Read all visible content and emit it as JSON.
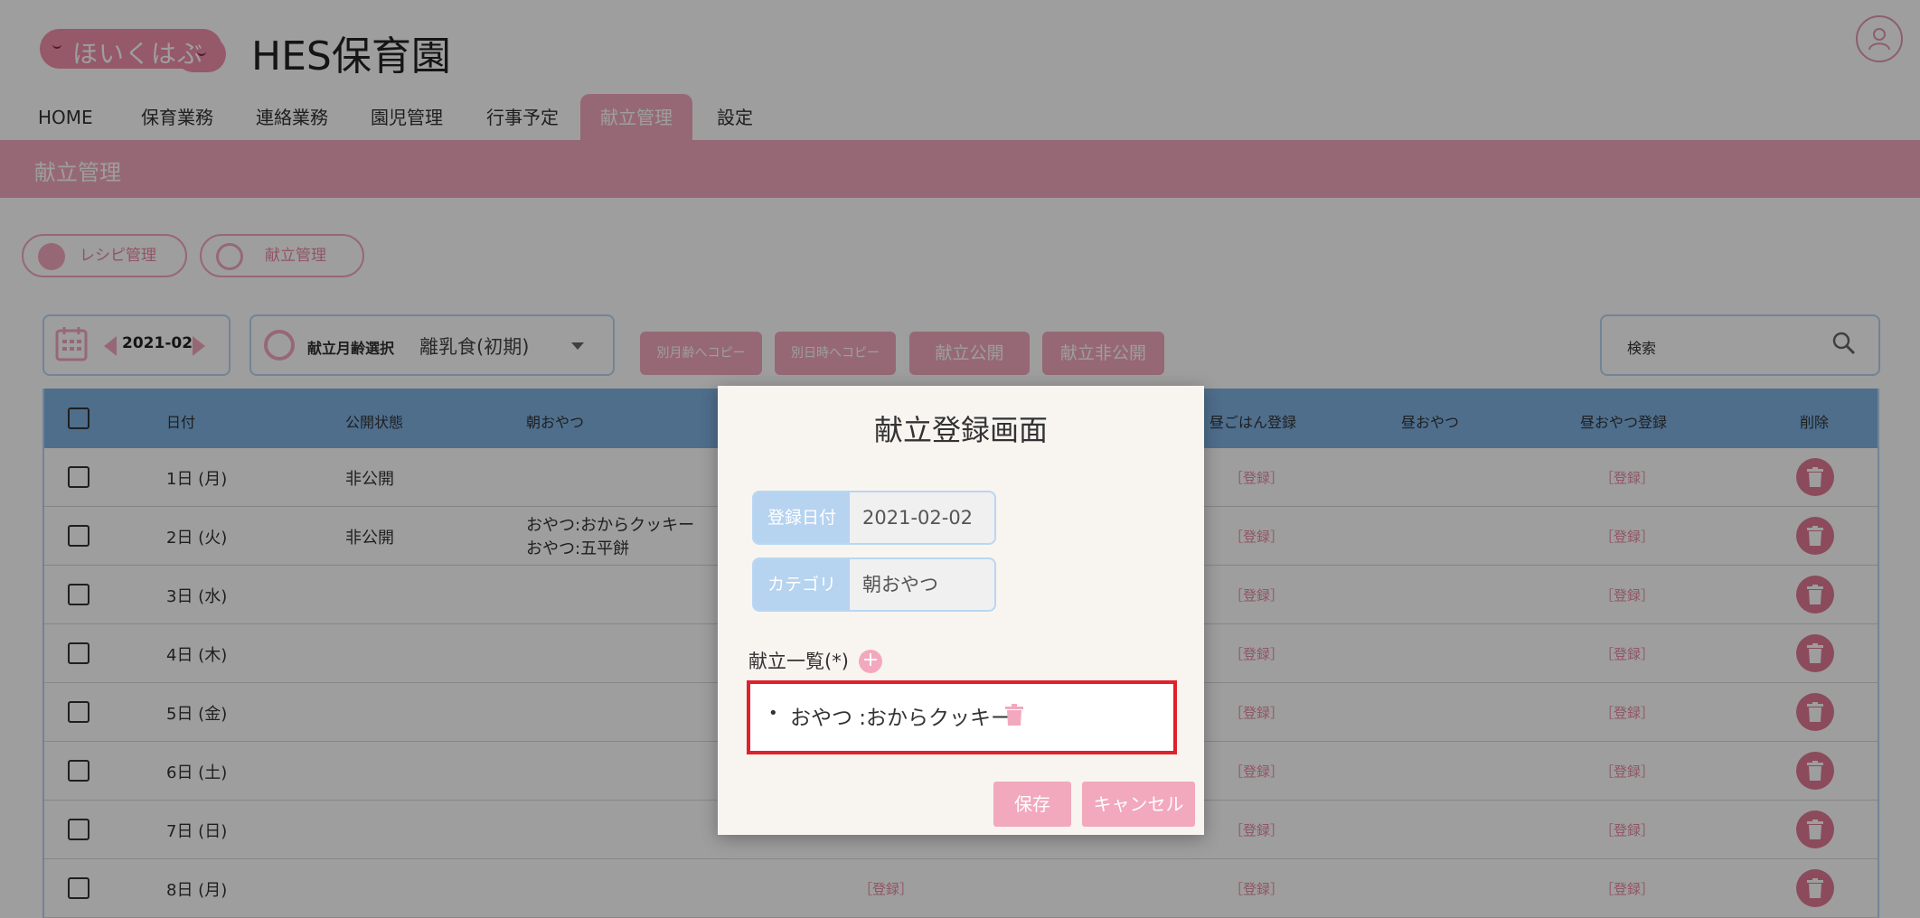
{
  "header": {
    "logo_text": "ほいくはぶ",
    "nursery_name": "HES保育園"
  },
  "nav": {
    "items": [
      "HOME",
      "保育業務",
      "連絡業務",
      "園児管理",
      "行事予定",
      "献立管理",
      "設定"
    ],
    "active": "献立管理"
  },
  "page": {
    "title": "献立管理"
  },
  "tabs": {
    "recipe": "レシピ管理",
    "menu": "献立管理"
  },
  "toolbar": {
    "month": "2021-02",
    "age_label": "献立月齢選択",
    "age_value": "離乳食(初期)",
    "copy_other_age": "別月齢へコピー",
    "copy_other_date": "別日時へコピー",
    "publish": "献立公開",
    "unpublish": "献立非公開",
    "search_placeholder": "検索"
  },
  "table": {
    "headers": {
      "date": "日付",
      "status": "公開状態",
      "morning_snack": "朝おやつ",
      "lunch_register": "昼ごはん登録",
      "afternoon_snack": "昼おやつ",
      "afternoon_snack_register": "昼おやつ登録",
      "delete": "削除"
    },
    "register_label": "［登録］",
    "rows": [
      {
        "date": "1日 (月)",
        "status": "非公開",
        "snack_line1": "",
        "snack_line2": ""
      },
      {
        "date": "2日 (火)",
        "status": "非公開",
        "snack_line1": "おやつ:おからクッキー",
        "snack_line2": "おやつ:五平餅"
      },
      {
        "date": "3日 (水)",
        "status": "",
        "snack_line1": "",
        "snack_line2": ""
      },
      {
        "date": "4日 (木)",
        "status": "",
        "snack_line1": "",
        "snack_line2": ""
      },
      {
        "date": "5日 (金)",
        "status": "",
        "snack_line1": "",
        "snack_line2": ""
      },
      {
        "date": "6日 (土)",
        "status": "",
        "snack_line1": "",
        "snack_line2": ""
      },
      {
        "date": "7日 (日)",
        "status": "",
        "snack_line1": "",
        "snack_line2": ""
      },
      {
        "date": "8日 (月)",
        "status": "",
        "snack_line1": "",
        "snack_line2": ""
      }
    ]
  },
  "modal": {
    "title": "献立登録画面",
    "date_label": "登録日付",
    "date_value": "2021-02-02",
    "category_label": "カテゴリ",
    "category_value": "朝おやつ",
    "list_label": "献立一覧(*)",
    "add_symbol": "+",
    "items": [
      "おやつ :おからクッキー"
    ],
    "bullet": "•",
    "save": "保存",
    "cancel": "キャンセル"
  },
  "colors": {
    "accent_pink": "#f2a9bd",
    "table_header_blue": "#7fb2e3",
    "highlight_red": "#e0202a"
  }
}
